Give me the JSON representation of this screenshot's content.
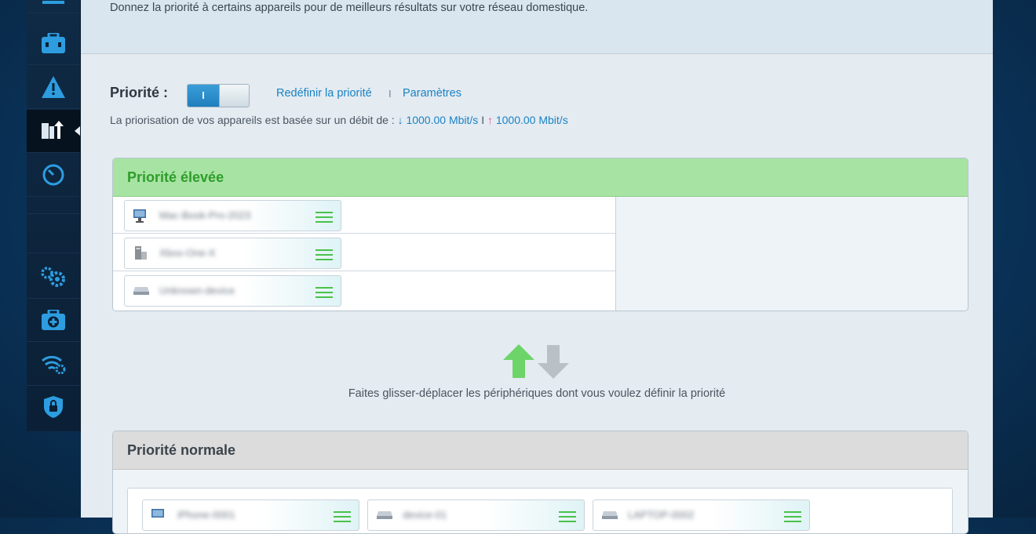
{
  "page": {
    "subtitle": "Donnez la priorité à certains appareils pour de meilleurs résultats sur votre réseau domestique.",
    "priority_label": "Priorité :",
    "toggle_state": "I",
    "reset_link": "Redéfinir la priorité",
    "separator": "I",
    "settings_link": "Paramètres",
    "rate_prefix": "La priorisation de vos appareils est basée sur un débit de :",
    "download_rate": "1000.00 Mbit/s",
    "rate_separator": "I",
    "upload_rate": "1000.00 Mbit/s",
    "drag_hint": "Faites glisser-déplacer les périphériques dont vous voulez définir la priorité"
  },
  "sidebar": {
    "items": [
      {
        "icon": "computer-icon"
      },
      {
        "icon": "toolbox-icon"
      },
      {
        "icon": "warning-icon"
      },
      {
        "icon": "prioritization-icon",
        "active": true
      },
      {
        "icon": "speedometer-icon"
      },
      {
        "icon": "settings-gears-icon"
      },
      {
        "icon": "first-aid-icon"
      },
      {
        "icon": "wifi-settings-icon"
      },
      {
        "icon": "security-shield-icon"
      }
    ]
  },
  "high_priority": {
    "title": "Priorité élevée",
    "devices": [
      {
        "name": "Mac-Book-Pro-2023",
        "icon": "monitor-icon"
      },
      {
        "name": "Xbox-One-X",
        "icon": "desktop-tower-icon"
      },
      {
        "name": "Unknown-device",
        "icon": "network-device-icon"
      }
    ]
  },
  "normal_priority": {
    "title": "Priorité normale",
    "devices": [
      {
        "name": "iPhone-0001",
        "icon": "monitor-icon"
      },
      {
        "name": "device-01",
        "icon": "network-device-icon"
      },
      {
        "name": "LAPTOP-0002",
        "icon": "network-device-icon"
      }
    ]
  },
  "colors": {
    "accent": "#1a83c4",
    "high_header": "#a7e3a3",
    "high_text": "#2e9d2a",
    "upload_arrow": "#e04f9a"
  }
}
